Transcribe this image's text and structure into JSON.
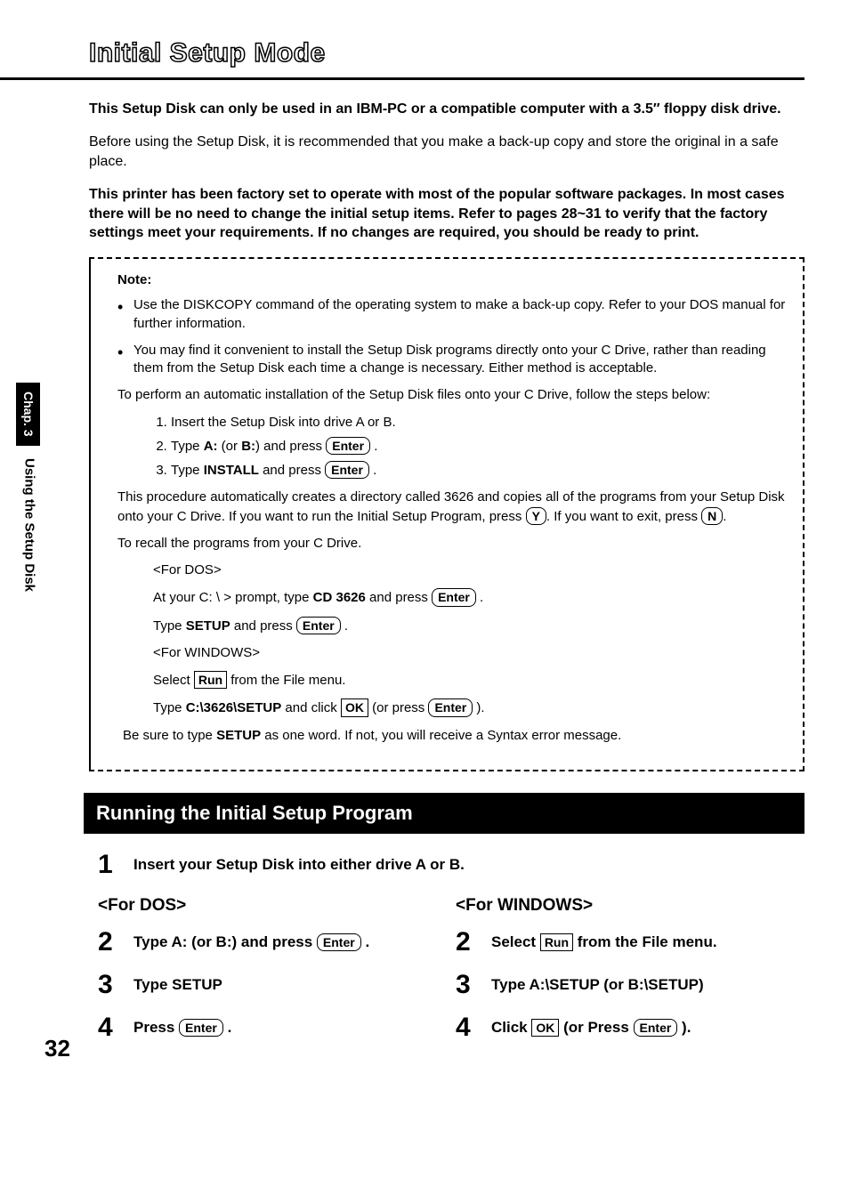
{
  "pageTitle": "Initial Setup Mode",
  "sideTab": {
    "chapter": "Chap. 3",
    "section": "Using the Setup Disk"
  },
  "intro": {
    "p1": "This Setup Disk can only be used in an IBM-PC or a compatible computer with a 3.5″ floppy disk drive.",
    "p2": "Before using the Setup Disk, it is recommended that you make a back-up copy and store the original in a safe place.",
    "p3": "This printer has been factory set to operate with most of the popular software packages. In most cases there will be no need to change the initial setup items. Refer to pages 28~31 to verify that the factory settings meet your requirements. If no changes are required, you should be ready to print."
  },
  "note": {
    "label": "Note:",
    "bullet1": "Use the DISKCOPY command of the operating system to make a back-up copy. Refer to your DOS manual for further information.",
    "bullet2": "You may find it convenient to install the Setup Disk programs directly onto your C Drive, rather than reading them from the Setup Disk each time a change is necessary. Either method is acceptable.",
    "autoInstall": "To perform an automatic installation of the Setup Disk files onto your C Drive, follow the steps below:",
    "ol1": "Insert the Setup Disk into drive A or B.",
    "ol2a": "Type ",
    "ol2b": "A:",
    "ol2c": " (or ",
    "ol2d": "B:",
    "ol2e": ") and press ",
    "ol3a": "Type ",
    "ol3b": "INSTALL",
    "ol3c": " and press ",
    "afterInstall_a": "This procedure automatically creates a directory called 3626 and copies all of the programs from your Setup Disk onto your C Drive. If you want to run the Initial Setup Program, press ",
    "afterInstall_b": ". If you want to exit, press ",
    "afterInstall_c": ".",
    "recall": "To recall the programs from your C Drive.",
    "forDos": "<For DOS>",
    "dosLine_a": "At your C: \\ > prompt, type ",
    "dosLine_b": "CD 3626",
    "dosLine_c": " and press ",
    "dosSetup_a": "Type ",
    "dosSetup_b": "SETUP",
    "dosSetup_c": " and press ",
    "forWin": "<For WINDOWS>",
    "winSel_a": "Select ",
    "winSel_b": " from the File menu.",
    "winType_a": "Type ",
    "winType_b": "C:\\3626\\SETUP",
    "winType_c": " and click ",
    "winType_d": " (or press ",
    "winType_e": " ).",
    "syntax_a": "Be sure to type ",
    "syntax_b": "SETUP",
    "syntax_c": " as one word. If not, you will receive a Syntax error message."
  },
  "keys": {
    "enter": "Enter",
    "y": "Y",
    "n": "N",
    "run": "Run",
    "ok": "OK"
  },
  "sectionHeading": "Running the Initial Setup Program",
  "run": {
    "step1": "Insert your Setup Disk into either drive A or B.",
    "dosHeader": "<For DOS>",
    "winHeader": "<For WINDOWS>",
    "d2a": "Type A: (or B:) and press ",
    "d3": "Type SETUP",
    "d4a": "Press ",
    "w2a": "Select ",
    "w2b": " from the File menu.",
    "w3": "Type A:\\SETUP (or B:\\SETUP)",
    "w4a": "Click ",
    "w4b": " (or Press ",
    "w4c": " )."
  },
  "pageNumber": "32"
}
